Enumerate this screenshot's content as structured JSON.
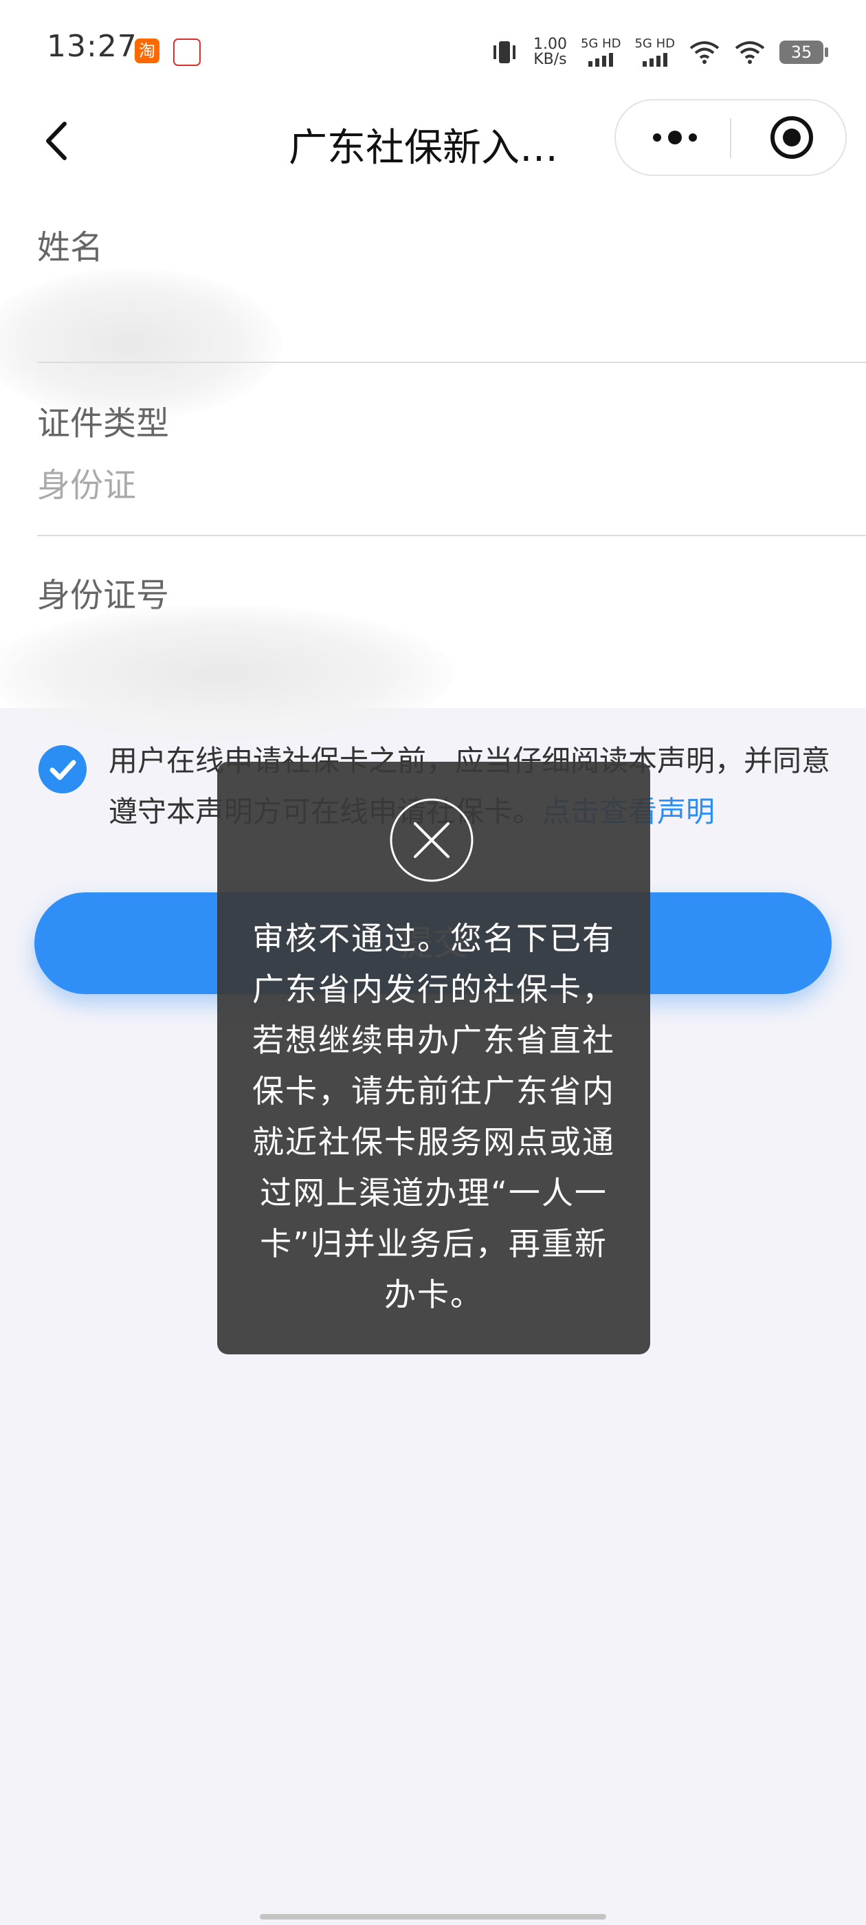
{
  "status_bar": {
    "time": "13:27",
    "net_speed_value": "1.00",
    "net_speed_unit": "KB/s",
    "sim1_label": "5G HD",
    "sim2_label": "5G HD",
    "battery": "35",
    "taobao_glyph": "淘"
  },
  "nav": {
    "title": "广东社保新入…"
  },
  "form": {
    "name_label": "姓名",
    "id_type_label": "证件类型",
    "id_type_value": "身份证",
    "id_number_label": "身份证号"
  },
  "agreement": {
    "text": "用户在线申请社保卡之前，应当仔细阅读本声明，并同意遵守本声明方可在线申请社保卡。",
    "link": "点击查看声明",
    "checked": true
  },
  "submit": {
    "label": "提交"
  },
  "toast": {
    "icon": "close-circle-icon",
    "message": "审核不通过。您名下已有广东省内发行的社保卡，若想继续申办广东省直社保卡，请先前往广东省内就近社保卡服务网点或通过网上渠道办理“一人一卡”归并业务后，再重新办卡。"
  },
  "colors": {
    "accent": "#2f8ff7",
    "toast_bg": "#3a3a3a",
    "page_bg": "#f3f3f9"
  }
}
